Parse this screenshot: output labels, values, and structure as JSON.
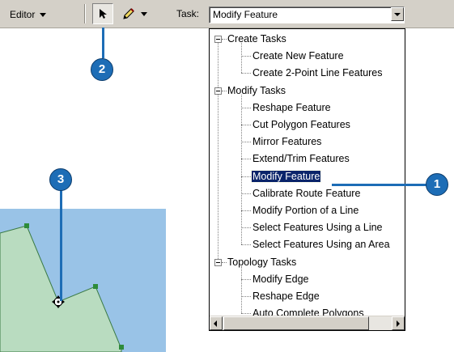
{
  "toolbar": {
    "editor_menu_label": "Editor",
    "select_tool_icon": "arrow-pointer-icon",
    "sketch_tool_icon": "pencil-icon",
    "task_label": "Task:",
    "task_value": "Modify Feature"
  },
  "task_tree": {
    "groups": [
      {
        "label": "Create Tasks",
        "items": [
          "Create New Feature",
          "Create 2-Point Line Features"
        ]
      },
      {
        "label": "Modify Tasks",
        "items": [
          "Reshape Feature",
          "Cut Polygon Features",
          "Mirror Features",
          "Extend/Trim Features",
          "Modify Feature",
          "Calibrate Route Feature",
          "Modify Portion of a Line",
          "Select Features Using a Line",
          "Select Features Using an Area"
        ]
      },
      {
        "label": "Topology Tasks",
        "items": [
          "Modify Edge",
          "Reshape Edge",
          "Auto Complete Polygons"
        ]
      }
    ],
    "selected": "Modify Feature"
  },
  "callouts": {
    "one": "1",
    "two": "2",
    "three": "3"
  },
  "colors": {
    "callout": "#1d6db6",
    "map_water": "#99c3e7",
    "polygon_fill": "#b9dcc0",
    "vertex": "#2e8b3a",
    "selection": "#0a246a"
  }
}
